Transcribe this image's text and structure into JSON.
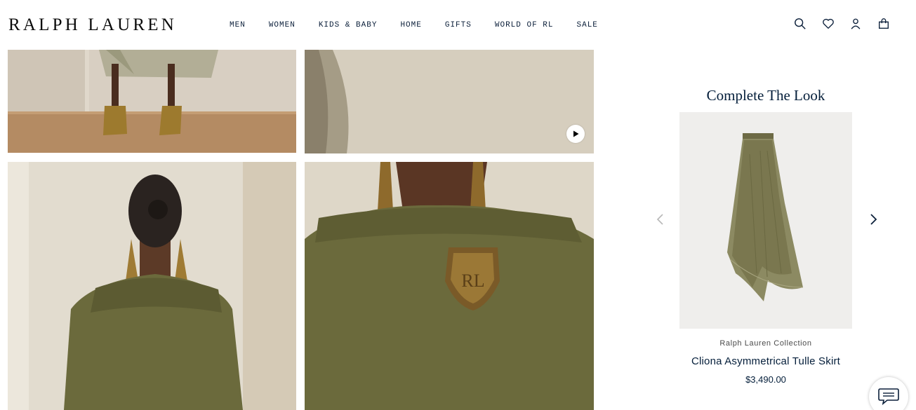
{
  "header": {
    "logo": "RALPH LAUREN",
    "nav": [
      "MEN",
      "WOMEN",
      "KIDS & BABY",
      "HOME",
      "GIFTS",
      "WORLD OF RL",
      "SALE"
    ],
    "icons": [
      "search-icon",
      "heart-icon",
      "account-icon",
      "bag-icon"
    ]
  },
  "gallery": {
    "images": [
      "model-legs-heels",
      "backdrop-video-still",
      "model-back-sweater",
      "model-front-sweater-crest"
    ],
    "crest_text": "RL",
    "video_icon": "play-icon"
  },
  "complete_the_look": {
    "title": "Complete The Look",
    "product": {
      "brand": "Ralph Lauren Collection",
      "name": "Cliona Asymmetrical Tulle Skirt",
      "price": "$3,490.00"
    },
    "prev_icon": "chevron-left-icon",
    "next_icon": "chevron-right-icon"
  },
  "chat": {
    "icon": "chat-icon"
  },
  "colors": {
    "navy": "#041e3a",
    "olive": "#6b6a3c",
    "backdrop": "#d9d1c4"
  }
}
